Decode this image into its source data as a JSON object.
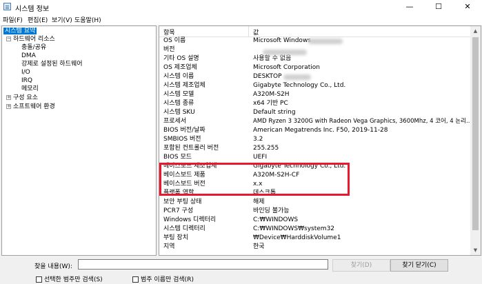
{
  "window": {
    "title": "시스템 정보",
    "controls": [
      "—",
      "☐",
      "✕"
    ]
  },
  "menu": [
    "파일(F)",
    "편집(E)",
    "보기(V)",
    "도움말(H)"
  ],
  "tree": [
    {
      "label": "시스템 요약",
      "level": 0,
      "selected": true,
      "expander": ""
    },
    {
      "label": "하드웨어 리소스",
      "level": 1,
      "selected": false,
      "expander": "−"
    },
    {
      "label": "충돌/공유",
      "level": 2,
      "selected": false,
      "expander": ""
    },
    {
      "label": "DMA",
      "level": 2,
      "selected": false,
      "expander": ""
    },
    {
      "label": "강제로 설정된 하드웨어",
      "level": 2,
      "selected": false,
      "expander": ""
    },
    {
      "label": "I/O",
      "level": 2,
      "selected": false,
      "expander": ""
    },
    {
      "label": "IRQ",
      "level": 2,
      "selected": false,
      "expander": ""
    },
    {
      "label": "메모리",
      "level": 2,
      "selected": false,
      "expander": ""
    },
    {
      "label": "구성 요소",
      "level": 1,
      "selected": false,
      "expander": "+"
    },
    {
      "label": "소프트웨어 환경",
      "level": 1,
      "selected": false,
      "expander": "+"
    }
  ],
  "table": {
    "headers": [
      "항목",
      "값"
    ],
    "rows": [
      {
        "item": "OS 이름",
        "value": "Microsoft Windows"
      },
      {
        "item": "버전",
        "value": ""
      },
      {
        "item": "기타 OS 설명",
        "value": "사용할 수 없음"
      },
      {
        "item": "OS 제조업체",
        "value": "Microsoft Corporation"
      },
      {
        "item": "시스템 이름",
        "value": "DESKTOP"
      },
      {
        "item": "시스템 제조업체",
        "value": "Gigabyte Technology Co., Ltd."
      },
      {
        "item": "시스템 모델",
        "value": "A320M-S2H"
      },
      {
        "item": "시스템 종류",
        "value": "x64 기반 PC"
      },
      {
        "item": "시스템 SKU",
        "value": "Default string"
      },
      {
        "item": "프로세서",
        "value": "AMD Ryzen 3 3200G with Radeon Vega Graphics, 3600Mhz, 4 코어, 4 논리..."
      },
      {
        "item": "BIOS 버전/날짜",
        "value": "American Megatrends Inc. F50, 2019-11-28"
      },
      {
        "item": "SMBIOS 버전",
        "value": "3.2"
      },
      {
        "item": "포함된 컨트롤러 버전",
        "value": "255.255"
      },
      {
        "item": "BIOS 모드",
        "value": "UEFI"
      },
      {
        "item": "베이스보드 제조업체",
        "value": "Gigabyte Technology Co., Ltd."
      },
      {
        "item": "베이스보드 제품",
        "value": "A320M-S2H-CF"
      },
      {
        "item": "베이스보드 버전",
        "value": "x.x"
      },
      {
        "item": "플랫폼 역할",
        "value": "데스크톱"
      },
      {
        "item": "보안 부팅 상태",
        "value": "해제"
      },
      {
        "item": "PCR7 구성",
        "value": "바인딩 불가능"
      },
      {
        "item": "Windows 디렉터리",
        "value": "C:₩WINDOWS"
      },
      {
        "item": "시스템 디렉터리",
        "value": "C:₩WINDOWS₩system32"
      },
      {
        "item": "부팅 장치",
        "value": "₩Device₩HarddiskVolume1"
      },
      {
        "item": "지역",
        "value": "한국"
      }
    ]
  },
  "find": {
    "label": "찾을 내용(W):",
    "input_value": "",
    "find_button": "찾기(D)",
    "close_button": "찾기 닫기(C)",
    "checkbox_selected": "선택한 범주만 검색(S)",
    "checkbox_names": "범주 이름만 검색(R)"
  },
  "colors": {
    "highlight_border": "#e8192c",
    "selection": "#0078d7"
  }
}
